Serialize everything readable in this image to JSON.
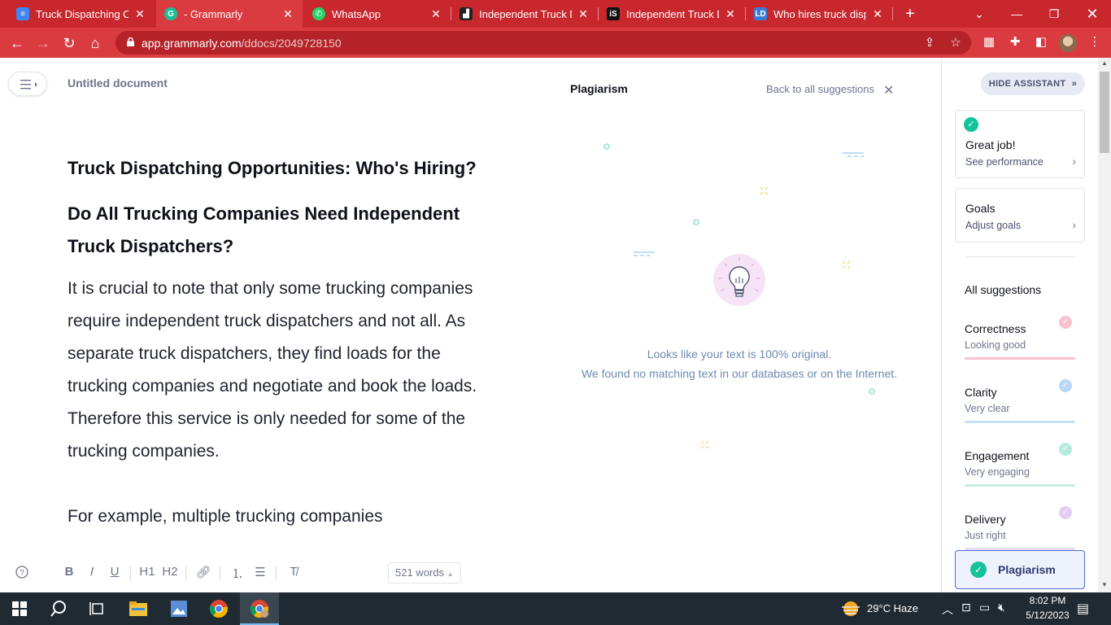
{
  "browser": {
    "tabs": [
      {
        "title": "Truck Dispatching Opp",
        "icon": "google-docs-icon"
      },
      {
        "title": "- Grammarly",
        "icon": "grammarly-icon",
        "active": true
      },
      {
        "title": "WhatsApp",
        "icon": "whatsapp-icon"
      },
      {
        "title": "Independent Truck Dis",
        "icon": "site-icon"
      },
      {
        "title": "Independent Truck Dis",
        "icon": "is-icon"
      },
      {
        "title": "Who hires truck dispa",
        "icon": "ld-icon"
      }
    ],
    "url_domain": "app.grammarly.com",
    "url_path": "/ddocs/2049728150"
  },
  "editor": {
    "doc_title": "Untitled document",
    "heading1": "Truck Dispatching Opportunities: Who's Hiring?",
    "heading2": "Do All Trucking Companies Need Independent Truck Dispatchers?",
    "paragraph1": "It is crucial to note that only some trucking companies require independent truck dispatchers and not all. As separate truck dispatchers, they find loads for the trucking companies and negotiate and book the loads. Therefore this service is only needed for some of the trucking companies.",
    "paragraph2": "For example, multiple trucking companies",
    "word_count": "521 words",
    "toolbar": {
      "bold": "B",
      "italic": "I",
      "underline": "U",
      "h1": "H1",
      "h2": "H2"
    }
  },
  "plagiarism": {
    "title": "Plagiarism",
    "back_label": "Back to all suggestions",
    "message1": "Looks like your text is 100% original.",
    "message2": "We found no matching text in our databases or on the Internet."
  },
  "sidebar": {
    "hide_label": "HIDE ASSISTANT",
    "performance": {
      "title": "Great job!",
      "link": "See performance"
    },
    "goals": {
      "title": "Goals",
      "link": "Adjust goals"
    },
    "all_suggestions": "All suggestions",
    "metrics": [
      {
        "name": "Correctness",
        "status": "Looking good",
        "color": "#f47f9b"
      },
      {
        "name": "Clarity",
        "status": "Very clear",
        "color": "#4a9eed"
      },
      {
        "name": "Engagement",
        "status": "Very engaging",
        "color": "#15c39a"
      },
      {
        "name": "Delivery",
        "status": "Just right",
        "color": "#b57fe0"
      }
    ],
    "plagiarism_label": "Plagiarism"
  },
  "taskbar": {
    "weather": "29°C  Haze",
    "time": "8:02 PM",
    "date": "5/12/2023"
  },
  "colors": {
    "browser_accent": "#c8272d",
    "grammarly_green": "#15c39a"
  }
}
